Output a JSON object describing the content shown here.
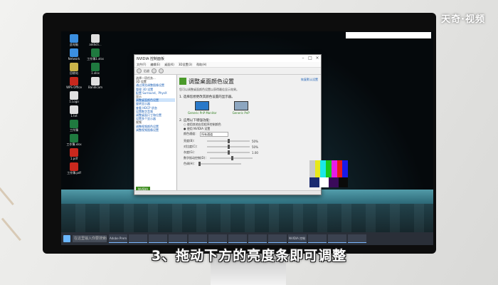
{
  "brand": {
    "logo_text": "天奇·视频"
  },
  "caption": "3、拖动下方的亮度条即可调整",
  "desktop_icons": [
    {
      "label": "此电脑",
      "color": "#3b8fe0"
    },
    {
      "label": "addicti...",
      "color": "#e0e0e0"
    },
    {
      "label": "Network",
      "color": "#3b8fe0"
    },
    {
      "label": "工作簿1.xlsx",
      "color": "#1f7a3f"
    },
    {
      "label": "回收站",
      "color": "#c9b34a"
    },
    {
      "label": "1.xlsx",
      "color": "#1f7a3f"
    },
    {
      "label": "WPS Office",
      "color": "#c8281d"
    },
    {
      "label": "Bandicam",
      "color": "#dfdfdf"
    },
    {
      "label": "1.Logo",
      "color": "#dfdfdf"
    },
    {
      "label": "",
      "color": "transparent"
    },
    {
      "label": "1.txt",
      "color": "#dfdfdf"
    },
    {
      "label": "",
      "color": "transparent"
    },
    {
      "label": "工作簿",
      "color": "#1f7a3f"
    },
    {
      "label": "",
      "color": "transparent"
    },
    {
      "label": "工作簿.xlsx",
      "color": "#1f7a3f"
    },
    {
      "label": "",
      "color": "transparent"
    },
    {
      "label": "1.pdf",
      "color": "#c8281d"
    },
    {
      "label": "",
      "color": "transparent"
    },
    {
      "label": "工作簿.pdf",
      "color": "#c8281d"
    }
  ],
  "taskbar": {
    "search_placeholder": "在这里输入你要搜索的内容",
    "apps": [
      "Adobe Prem",
      "",
      "",
      "",
      "",
      "",
      "",
      "",
      "",
      "NVIDIA 控制",
      "",
      "",
      ""
    ],
    "clock_time": "",
    "clock_date": ""
  },
  "window": {
    "title": "NVIDIA 控制面板",
    "menu": [
      "文件(F)",
      "编辑(E)",
      "桌面(K)",
      "3D设置(3)",
      "帮助(H)"
    ],
    "toolbar_label": "后退",
    "tree": [
      {
        "text": "选择一项任务...",
        "type": "hdr"
      },
      {
        "text": "3D 设置",
        "type": "hdr"
      },
      {
        "text": "通过预览调整图像设置",
        "type": "item"
      },
      {
        "text": "管理 3D 设置",
        "type": "item"
      },
      {
        "text": "配置 Surround、PhysX",
        "type": "item"
      },
      {
        "text": "显示",
        "type": "hdr"
      },
      {
        "text": "调整桌面颜色设置",
        "type": "sel"
      },
      {
        "text": "旋转显示器",
        "type": "item"
      },
      {
        "text": "查看 HDCP 状态",
        "type": "item"
      },
      {
        "text": "设置数字音频",
        "type": "item"
      },
      {
        "text": "调整桌面尺寸和位置",
        "type": "item"
      },
      {
        "text": "设置多个显示器",
        "type": "item"
      },
      {
        "text": "视频",
        "type": "hdr"
      },
      {
        "text": "调整视频颜色设置",
        "type": "item"
      },
      {
        "text": "调整视频图像设置",
        "type": "item"
      }
    ],
    "tree_logo": "NVIDIA",
    "page_title": "调整桌面颜色设置",
    "restore_link": "恢复默认设置",
    "description": "您可以调整桌面颜色设置以获得最佳显示效果。",
    "section1": "1. 选择您想更改其颜色设置的显示器。",
    "displays": [
      {
        "caption": "Generic PnP Monitor"
      },
      {
        "caption": "Generic PnP"
      }
    ],
    "section2": "2. 应用以下增强功能：",
    "radio1": "使用其他应用程序控制颜色",
    "radio2": "使用 NVIDIA 设置",
    "channel_label": "颜色通道：",
    "channel_value": "所有通道",
    "sliders": [
      {
        "label": "亮度(B)：",
        "fraction": 0.5,
        "value": "50%"
      },
      {
        "label": "对比度(C)：",
        "fraction": 0.5,
        "value": "50%"
      },
      {
        "label": "灰度(G)：",
        "fraction": 0.5,
        "value": "1.00"
      }
    ],
    "digital_vibrance_label": "数字振动控制(D)：",
    "hue_label": "色调(H)：",
    "test_bar_colors": [
      "#c8c8c8",
      "#e8e81a",
      "#1ae8e8",
      "#1ac81a",
      "#e81ae8",
      "#e81a1a",
      "#1a1ae8"
    ],
    "test_lower_colors": [
      "#1a2a70",
      "#ffffff",
      "#3a0a5a",
      "#0a0a0a"
    ]
  }
}
